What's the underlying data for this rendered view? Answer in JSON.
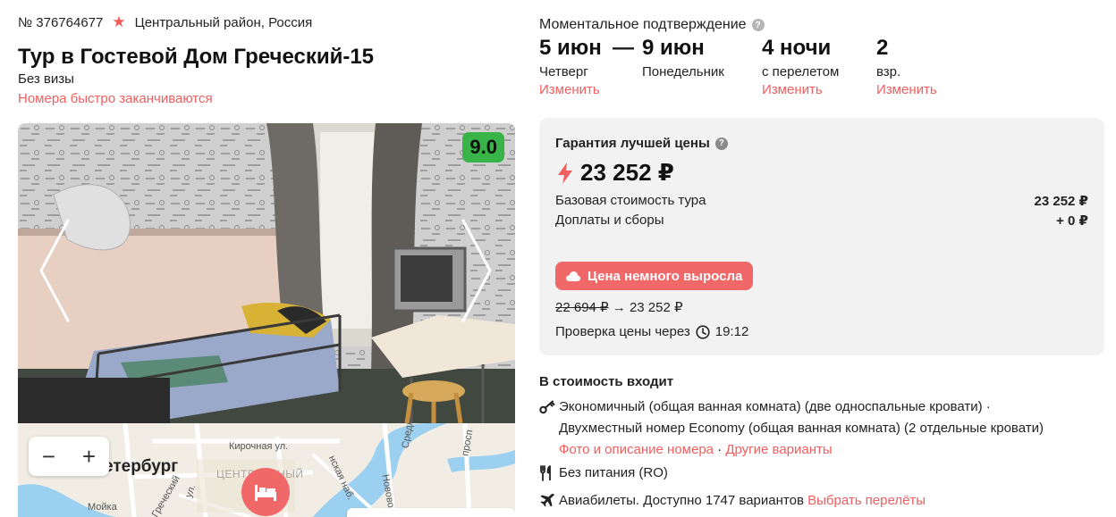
{
  "tour": {
    "number": "№ 376764677",
    "location": "Центральный район, Россия",
    "title": "Тур в Гостевой Дом Греческий-15",
    "visa": "Без визы",
    "hurry": "Номера быстро заканчиваются",
    "rating": "9.0"
  },
  "map": {
    "city": "етербург",
    "district": "ЦЕНТРАЛЬНЫЙ",
    "streets": [
      "Кирочная ул.",
      "Средн",
      "просп",
      "ул.",
      "Мойка",
      "нская наб.",
      "Новово",
      "Греческий"
    ],
    "zoom_out": "−",
    "zoom_in": "+"
  },
  "booking": {
    "confirmation": "Моментальное подтверждение",
    "date_from": {
      "value": "5 июн",
      "weekday": "Четверг",
      "change": "Изменить"
    },
    "dash": "—",
    "date_to": {
      "value": "9 июн",
      "weekday": "Понедельник"
    },
    "nights": {
      "value": "4 ночи",
      "note": "с перелетом",
      "change": "Изменить"
    },
    "adults": {
      "value": "2",
      "note": "взр.",
      "change": "Изменить"
    }
  },
  "price": {
    "guarantee": "Гарантия лучшей цены",
    "total": "23 252 ₽",
    "base_label": "Базовая стоимость тура",
    "base_value": "23 252 ₽",
    "fees_label": "Доплаты и сборы",
    "fees_value": "+ 0 ₽",
    "rise_label": "Цена немного выросла",
    "old_price": "22 694 ₽",
    "arrow": "→",
    "new_price": "23 252 ₽",
    "check_label": "Проверка цены через",
    "check_time": "19:12"
  },
  "includes": {
    "title": "В стоимость входит",
    "room_line1": "Экономичный (общая ванная комната) (две односпальные кровати) ·",
    "room_line2": "Двухместный номер Economy (общая ванная комната) (2 отдельные кровати)",
    "room_photo_link": "Фото и описание номера",
    "sep": " · ",
    "room_other_link": "Другие варианты",
    "meal": "Без питания (RO)",
    "flights": "Авиабилеты. Доступно 1747 вариантов",
    "flights_link": "Выбрать перелёты"
  },
  "icons": {
    "star": "star-icon",
    "question": "question-icon",
    "bolt": "lightning-icon",
    "cloud": "cloud-icon",
    "clock": "clock-icon",
    "key": "key-icon",
    "meal": "fork-knife-icon",
    "plane": "plane-icon",
    "bed": "bed-icon"
  },
  "colors": {
    "accent": "#f05f5f",
    "rating_bg": "#38b449",
    "panel_bg": "#f2f2f2"
  }
}
